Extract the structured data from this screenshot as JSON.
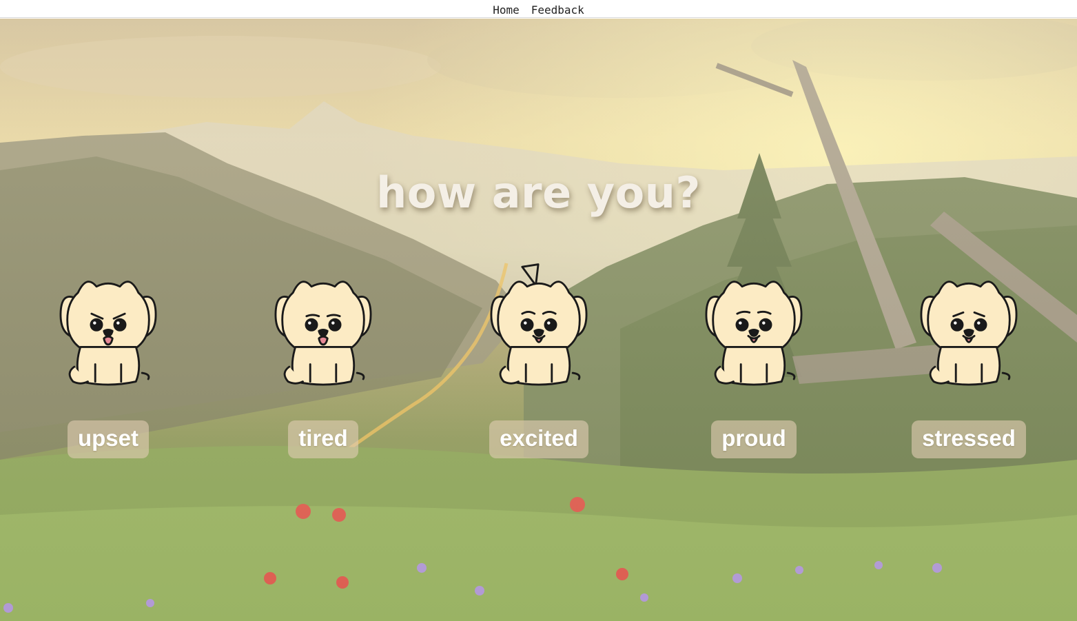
{
  "nav": {
    "home": "Home",
    "feedback": "Feedback"
  },
  "prompt": "how are you?",
  "moods": [
    {
      "label": "upset",
      "icon": "upset-dog-icon"
    },
    {
      "label": "tired",
      "icon": "tired-dog-icon"
    },
    {
      "label": "excited",
      "icon": "excited-dog-icon"
    },
    {
      "label": "proud",
      "icon": "proud-dog-icon"
    },
    {
      "label": "stressed",
      "icon": "stressed-dog-icon"
    }
  ],
  "colors": {
    "dog_fill": "#fcebc4",
    "dog_outline": "#1a1a1a",
    "tongue": "#e88a96",
    "label_bg": "#dfcdb2",
    "title_text": "#f4efe6"
  }
}
